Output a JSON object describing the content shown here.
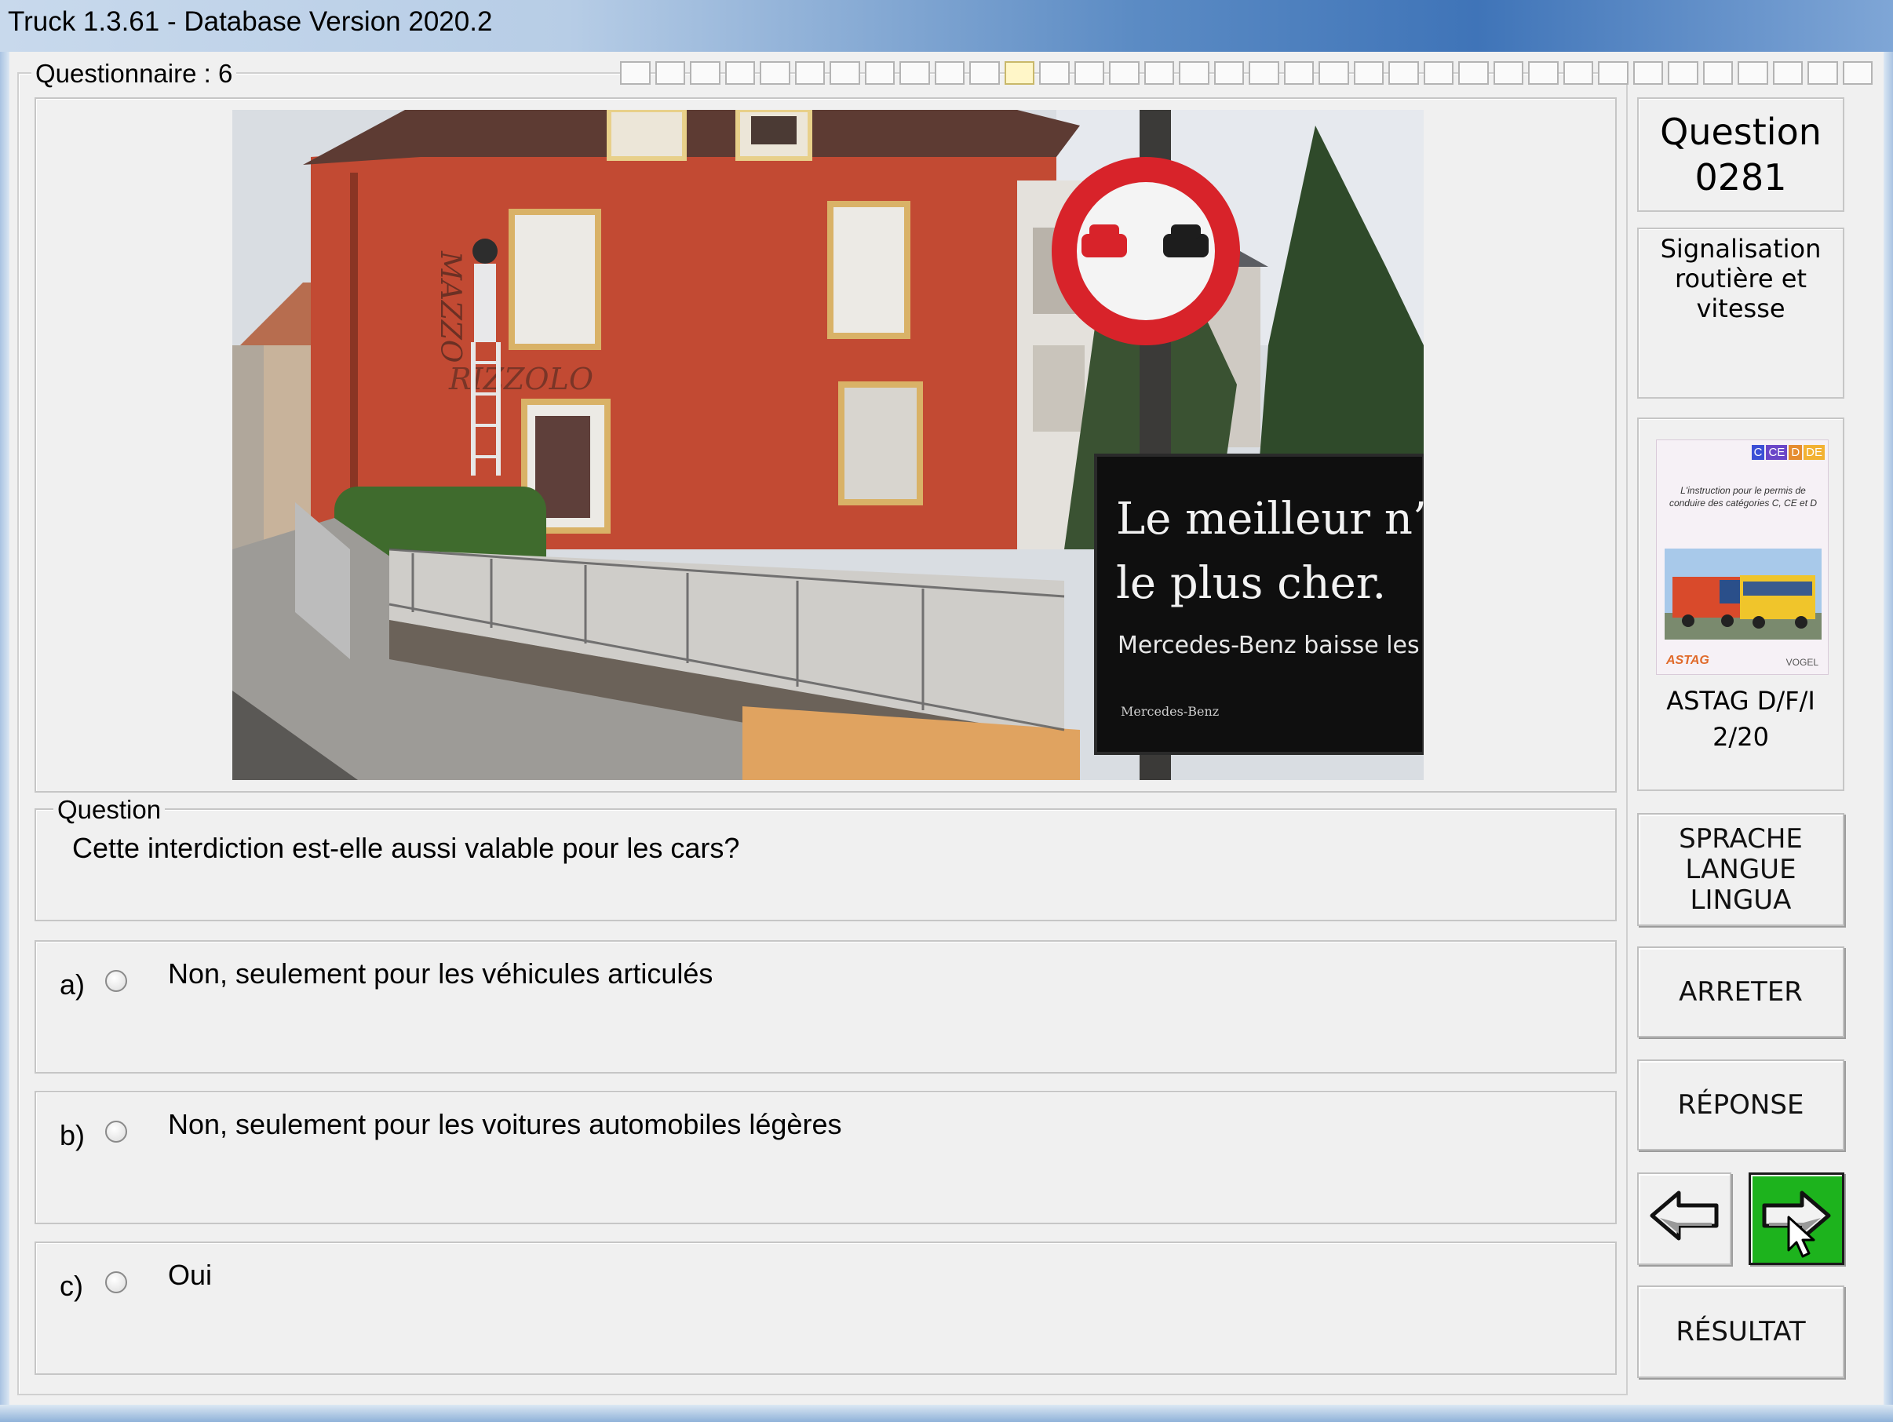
{
  "window": {
    "title": "Truck 1.3.61 - Database Version 2020.2"
  },
  "questionnaire": {
    "label": "Questionnaire : 6",
    "progress_cells": 36,
    "progress_current_index": 11
  },
  "photo": {
    "billboard_line1": "Le meilleur n’est",
    "billboard_line2": "le plus cher.",
    "billboard_line3": "Mercedes-Benz baisse les",
    "billboard_brand": "Mercedes-Benz",
    "wall_text_vertical": "MAZZO",
    "wall_text": "RIZZOLO",
    "sign": "no-overtaking-sign"
  },
  "question_panel": {
    "legend": "Question",
    "text": "Cette interdiction est-elle aussi valable pour les cars?"
  },
  "answers": [
    {
      "letter": "a)",
      "text": "Non, seulement pour les véhicules articulés",
      "selected": false
    },
    {
      "letter": "b)",
      "text": "Non, seulement pour les voitures automobiles légères",
      "selected": false
    },
    {
      "letter": "c)",
      "text": "Oui",
      "selected": false
    }
  ],
  "sidebar": {
    "question_label": "Question",
    "question_number": "0281",
    "category": "Signalisation routière et vitesse",
    "book": {
      "badges": [
        "C",
        "CE",
        "D",
        "DE"
      ],
      "blurb": "L'instruction pour le permis de conduire des catégories C, CE et D",
      "publisher_left": "ASTAG",
      "publisher_right": "VOGEL",
      "caption_line1": "ASTAG D/F/I",
      "caption_line2": "2/20"
    },
    "language_button": "SPRACHE\nLANGUE\nLINGUA",
    "stop_button": "ARRETER",
    "answer_button": "RÉPONSE",
    "prev_icon": "arrow-left-icon",
    "next_icon": "arrow-right-icon",
    "result_button": "RÉSULTAT"
  },
  "colors": {
    "next_button_bg": "#1db31d",
    "sign_red": "#d8232a",
    "building": "#c24a33"
  }
}
